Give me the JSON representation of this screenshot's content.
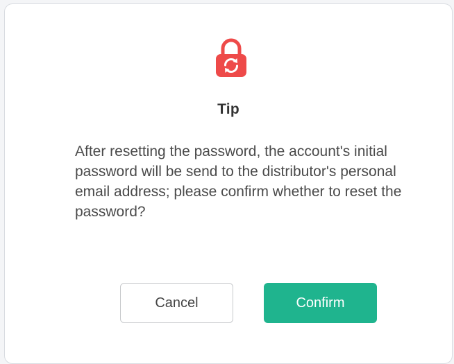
{
  "dialog": {
    "title": "Tip",
    "message": "After resetting the password, the account's initial password will be send to the distributor's personal email address; please confirm whether to reset the password?",
    "icon": "lock-reset-icon",
    "cancel_label": "Cancel",
    "confirm_label": "Confirm"
  },
  "colors": {
    "icon": "#ee4a49",
    "confirm_button": "#1fb48e"
  }
}
